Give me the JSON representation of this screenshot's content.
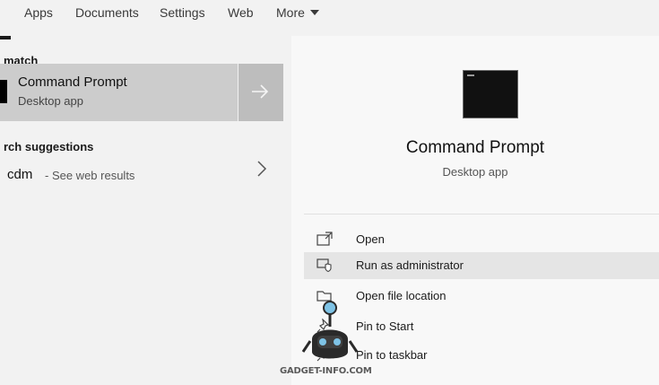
{
  "tabs": [
    {
      "label": "Apps"
    },
    {
      "label": "Documents"
    },
    {
      "label": "Settings"
    },
    {
      "label": "Web"
    },
    {
      "label": "More"
    }
  ],
  "left": {
    "best_match_heading": "match",
    "best_match": {
      "title": "Command Prompt",
      "subtitle": "Desktop app",
      "icon": "cmd-terminal-icon"
    },
    "suggestions_heading": "rch suggestions",
    "suggestion": {
      "query": "cdm",
      "hint": "- See web results"
    }
  },
  "detail": {
    "title": "Command Prompt",
    "subtitle": "Desktop app",
    "actions": [
      {
        "label": "Open",
        "icon": "open-window-icon"
      },
      {
        "label": "Run as administrator",
        "icon": "shield-admin-icon"
      },
      {
        "label": "Open file location",
        "icon": "folder-icon"
      },
      {
        "label": "Pin to Start",
        "icon": "pin-icon"
      },
      {
        "label": "Pin to taskbar",
        "icon": "pin-icon"
      }
    ]
  },
  "watermark": {
    "text": "GADGET-INFO.COM"
  },
  "colors": {
    "pane_bg": "#f2f2f2",
    "selected_row": "#cccccc",
    "arrow_tile": "#bdbdbd",
    "hover_row": "#e5e5e5"
  }
}
